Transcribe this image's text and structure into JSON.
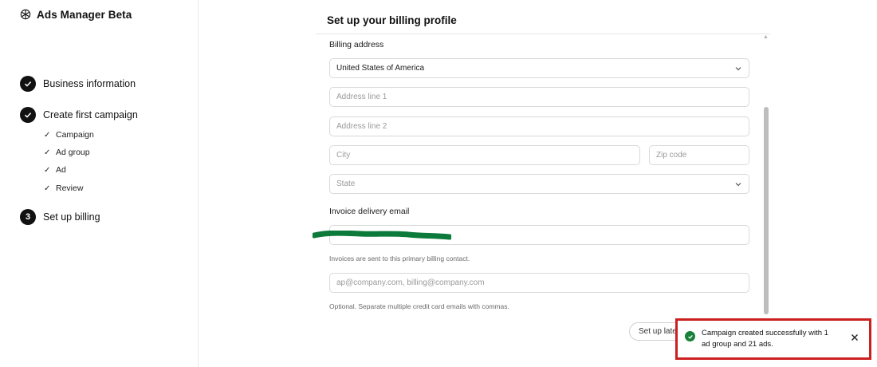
{
  "app": {
    "title": "Ads Manager Beta",
    "logo_icon": "openai-logo-icon"
  },
  "steps": [
    {
      "label": "Business information",
      "status": "done",
      "icon": "check-icon"
    },
    {
      "label": "Create first campaign",
      "status": "done",
      "icon": "check-icon",
      "substeps": [
        {
          "label": "Campaign",
          "tick": "✓"
        },
        {
          "label": "Ad group",
          "tick": "✓"
        },
        {
          "label": "Ad",
          "tick": "✓"
        },
        {
          "label": "Review",
          "tick": "✓"
        }
      ]
    },
    {
      "label": "Set up billing",
      "status": "current",
      "number": "3"
    }
  ],
  "main": {
    "title": "Set up your billing profile",
    "billing_address": {
      "label": "Billing address",
      "country": "United States of America",
      "address1_placeholder": "Address line 1",
      "address2_placeholder": "Address line 2",
      "city_placeholder": "City",
      "zip_placeholder": "Zip code",
      "state_placeholder": "State"
    },
    "invoice": {
      "label": "Invoice delivery email",
      "primary_helper": "Invoices are sent to this primary billing contact.",
      "cc_placeholder": "ap@company.com, billing@company.com",
      "cc_helper": "Optional. Separate multiple credit card emails with commas."
    },
    "later_button": "Set up later"
  },
  "toast": {
    "message": "Campaign created successfully with 1 ad group and 21 ads.",
    "status": "success"
  },
  "colors": {
    "toast_border": "#cc1f1f",
    "success": "#188038",
    "redaction": "#0b7a3b"
  }
}
